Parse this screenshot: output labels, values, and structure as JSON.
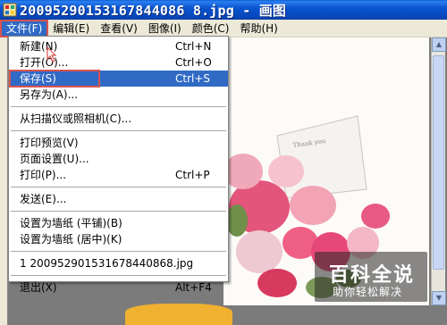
{
  "window": {
    "title": "20095290153167844086 8.jpg - 画图"
  },
  "menubar": {
    "items": [
      {
        "label": "文件(F)"
      },
      {
        "label": "编辑(E)"
      },
      {
        "label": "查看(V)"
      },
      {
        "label": "图像(I)"
      },
      {
        "label": "颜色(C)"
      },
      {
        "label": "帮助(H)"
      }
    ]
  },
  "file_menu": {
    "items": [
      {
        "label": "新建(N)",
        "shortcut": "Ctrl+N"
      },
      {
        "label": "打开(O)...",
        "shortcut": "Ctrl+O"
      },
      {
        "label": "保存(S)",
        "shortcut": "Ctrl+S"
      },
      {
        "label": "另存为(A)..."
      },
      {
        "label": "从扫描仪或照相机(C)..."
      },
      {
        "label": "打印预览(V)"
      },
      {
        "label": "页面设置(U)..."
      },
      {
        "label": "打印(P)...",
        "shortcut": "Ctrl+P"
      },
      {
        "label": "发送(E)..."
      },
      {
        "label": "设置为墙纸 (平铺)(B)"
      },
      {
        "label": "设置为墙纸 (居中)(K)"
      },
      {
        "label": "1 200952901531678440868.jpg"
      },
      {
        "label": "退出(X)",
        "shortcut": "Alt+F4"
      }
    ]
  },
  "canvas": {
    "card_text": "Thank you"
  },
  "watermark": {
    "line1": "百科全说",
    "line2": "助你轻松解决"
  },
  "colors": {
    "accent": "#316ac5",
    "highlight_outline": "#d9534f",
    "titlebar": "#0a55d0"
  }
}
